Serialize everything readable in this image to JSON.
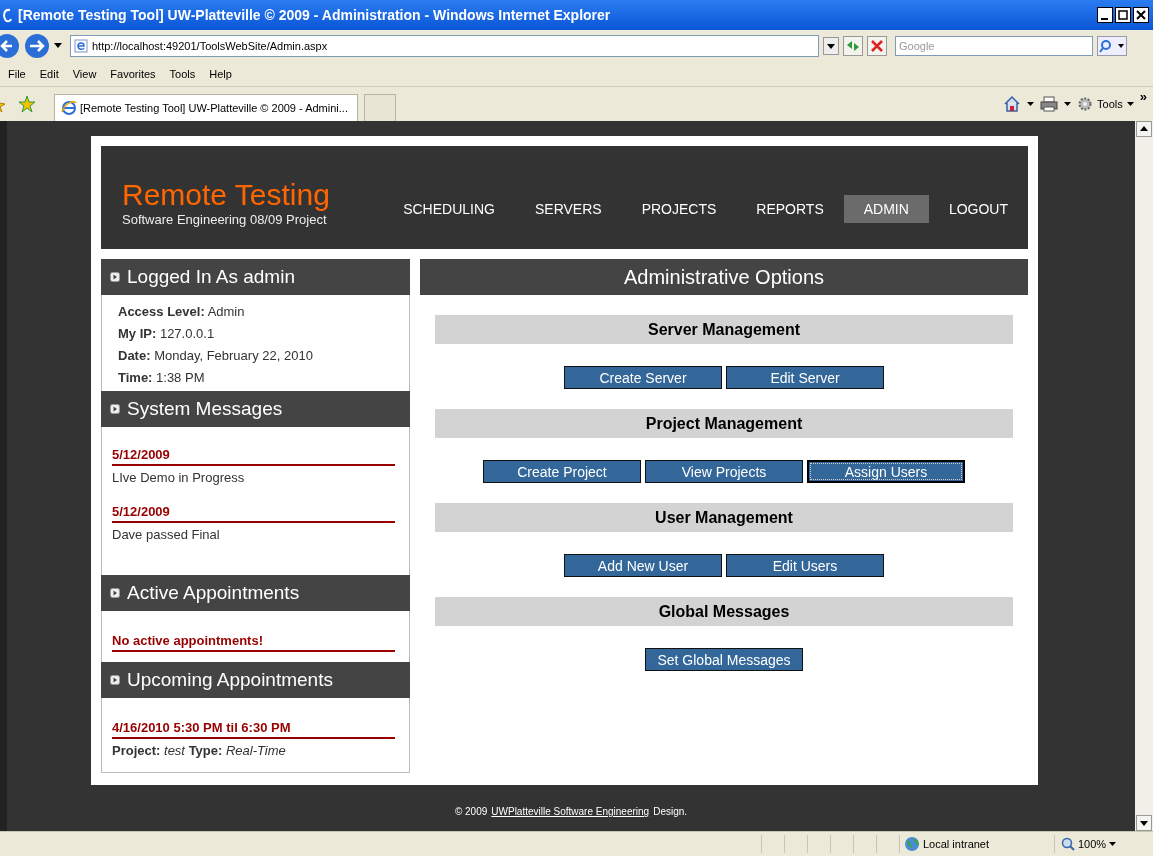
{
  "window": {
    "title": "[Remote Testing Tool] UW-Platteville © 2009 - Administration - Windows Internet Explorer"
  },
  "address_bar": {
    "url": "http://localhost:49201/ToolsWebSite/Admin.aspx",
    "search_placeholder": "Google"
  },
  "menu": [
    "File",
    "Edit",
    "View",
    "Favorites",
    "Tools",
    "Help"
  ],
  "tabs": [
    {
      "label": "[Remote Testing Tool] UW-Platteville © 2009 - Admini...",
      "selected": true
    }
  ],
  "command_bar": {
    "tools_label": "Tools",
    "more": "»"
  },
  "page": {
    "header": {
      "logo": "Remote Testing",
      "subtitle": "Software Engineering 08/09 Project",
      "nav": [
        {
          "label": "SCHEDULING",
          "selected": false
        },
        {
          "label": "SERVERS",
          "selected": false
        },
        {
          "label": "PROJECTS",
          "selected": false
        },
        {
          "label": "REPORTS",
          "selected": false
        },
        {
          "label": "ADMIN",
          "selected": true
        },
        {
          "label": "LOGOUT",
          "selected": false
        }
      ]
    },
    "sidebar": [
      {
        "kind": "info",
        "title": "Logged In As admin",
        "fields": [
          {
            "label": "Access Level:",
            "value": "Admin"
          },
          {
            "label": "My IP:",
            "value": "127.0.0.1"
          },
          {
            "label": "Date:",
            "value": "Monday, February 22, 2010"
          },
          {
            "label": "Time:",
            "value": "1:38 PM"
          }
        ]
      },
      {
        "kind": "messages",
        "title": "System Messages",
        "messages": [
          {
            "date": "5/12/2009",
            "text": "LIve Demo in Progress"
          },
          {
            "date": "5/12/2009",
            "text": "Dave passed Final"
          }
        ]
      },
      {
        "kind": "notice",
        "title": "Active Appointments",
        "text": "No active appointments!"
      },
      {
        "kind": "appointments",
        "title": "Upcoming Appointments",
        "items": [
          {
            "time": "4/16/2010 5:30 PM til 6:30 PM",
            "detail": "**Project:** *test* **Type:** *Real-Time*"
          }
        ]
      }
    ],
    "main": {
      "title": "Administrative Options",
      "groups": [
        {
          "heading": "Server Management",
          "buttons": [
            {
              "label": "Create Server",
              "focused": false
            },
            {
              "label": "Edit Server",
              "focused": false
            }
          ]
        },
        {
          "heading": "Project Management",
          "buttons": [
            {
              "label": "Create Project",
              "focused": false
            },
            {
              "label": "View Projects",
              "focused": false
            },
            {
              "label": "Assign Users",
              "focused": true
            }
          ]
        },
        {
          "heading": "User Management",
          "buttons": [
            {
              "label": "Add New User",
              "focused": false
            },
            {
              "label": "Edit Users",
              "focused": false
            }
          ]
        },
        {
          "heading": "Global Messages",
          "buttons": [
            {
              "label": "Set Global Messages",
              "focused": false
            }
          ]
        }
      ]
    },
    "footer": {
      "prefix": "© 2009",
      "link": "UWPlatteville Software Engineering",
      "suffix": "Design."
    }
  },
  "status_bar": {
    "zone": "Local intranet",
    "zoom": "100%"
  }
}
